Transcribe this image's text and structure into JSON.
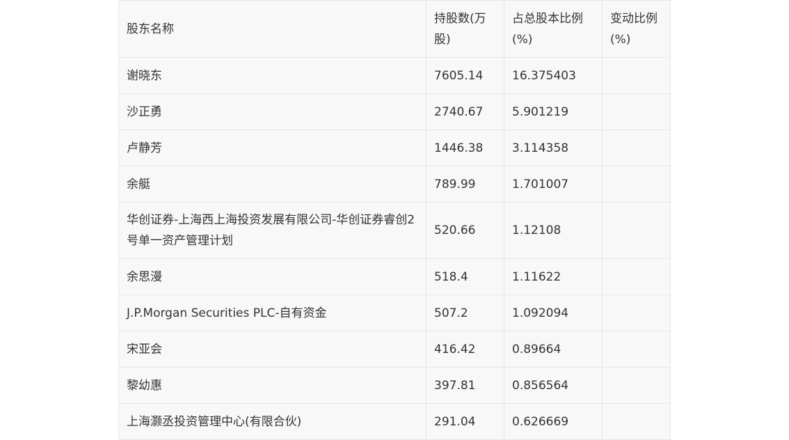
{
  "table": {
    "headers": [
      "股东名称",
      "持股数(万股)",
      "占总股本比例(%)",
      "变动比例(%)"
    ],
    "rows": [
      {
        "name": "谢晓东",
        "shares": "7605.14",
        "ratio": "16.375403",
        "change": ""
      },
      {
        "name": "沙正勇",
        "shares": "2740.67",
        "ratio": "5.901219",
        "change": ""
      },
      {
        "name": "卢静芳",
        "shares": "1446.38",
        "ratio": "3.114358",
        "change": ""
      },
      {
        "name": "余艇",
        "shares": "789.99",
        "ratio": "1.701007",
        "change": ""
      },
      {
        "name": "华创证券-上海西上海投资发展有限公司-华创证券睿创2号单一资产管理计划",
        "shares": "520.66",
        "ratio": "1.12108",
        "change": ""
      },
      {
        "name": "余思漫",
        "shares": "518.4",
        "ratio": "1.11622",
        "change": ""
      },
      {
        "name": "J.P.Morgan Securities PLC-自有资金",
        "shares": "507.2",
        "ratio": "1.092094",
        "change": ""
      },
      {
        "name": "宋亚会",
        "shares": "416.42",
        "ratio": "0.89664",
        "change": ""
      },
      {
        "name": "黎幼惠",
        "shares": "397.81",
        "ratio": "0.856564",
        "change": ""
      },
      {
        "name": "上海灏丞投资管理中心(有限合伙)",
        "shares": "291.04",
        "ratio": "0.626669",
        "change": ""
      }
    ]
  }
}
